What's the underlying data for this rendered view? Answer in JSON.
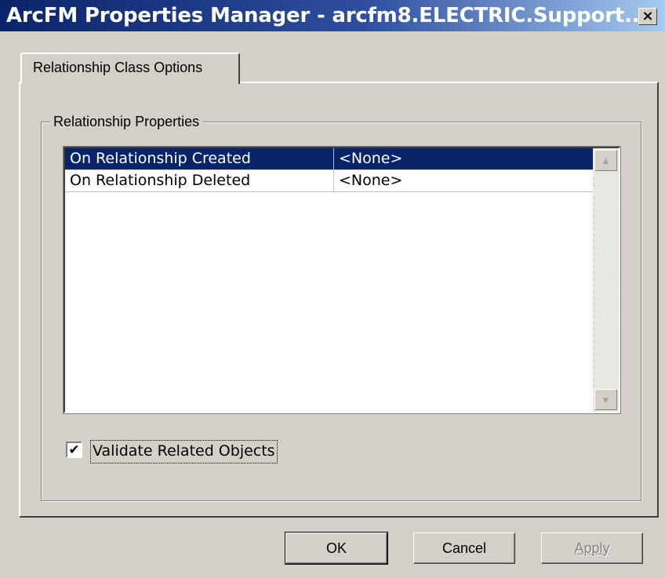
{
  "window": {
    "title": "ArcFM Properties Manager - arcfm8.ELECTRIC.Support...",
    "close_glyph": "×"
  },
  "tabs": [
    {
      "label": "Relationship Class Options",
      "selected": true
    }
  ],
  "group": {
    "label": "Relationship Properties"
  },
  "properties_grid": {
    "rows": [
      {
        "property": "On Relationship Created",
        "value": "<None>",
        "selected": true
      },
      {
        "property": "On Relationship Deleted",
        "value": "<None>",
        "selected": false
      }
    ]
  },
  "scrollbar": {
    "up_glyph": "▲",
    "down_glyph": "▼"
  },
  "validate_checkbox": {
    "label": "Validate Related Objects",
    "checked": true,
    "check_glyph": "✔"
  },
  "buttons": {
    "ok_label": "OK",
    "cancel_label": "Cancel",
    "apply_label": "Apply"
  },
  "colors": {
    "face": "#d4d0c8",
    "titlebar_start": "#0a246a",
    "titlebar_end": "#a6caf0",
    "selection": "#0a246a"
  }
}
